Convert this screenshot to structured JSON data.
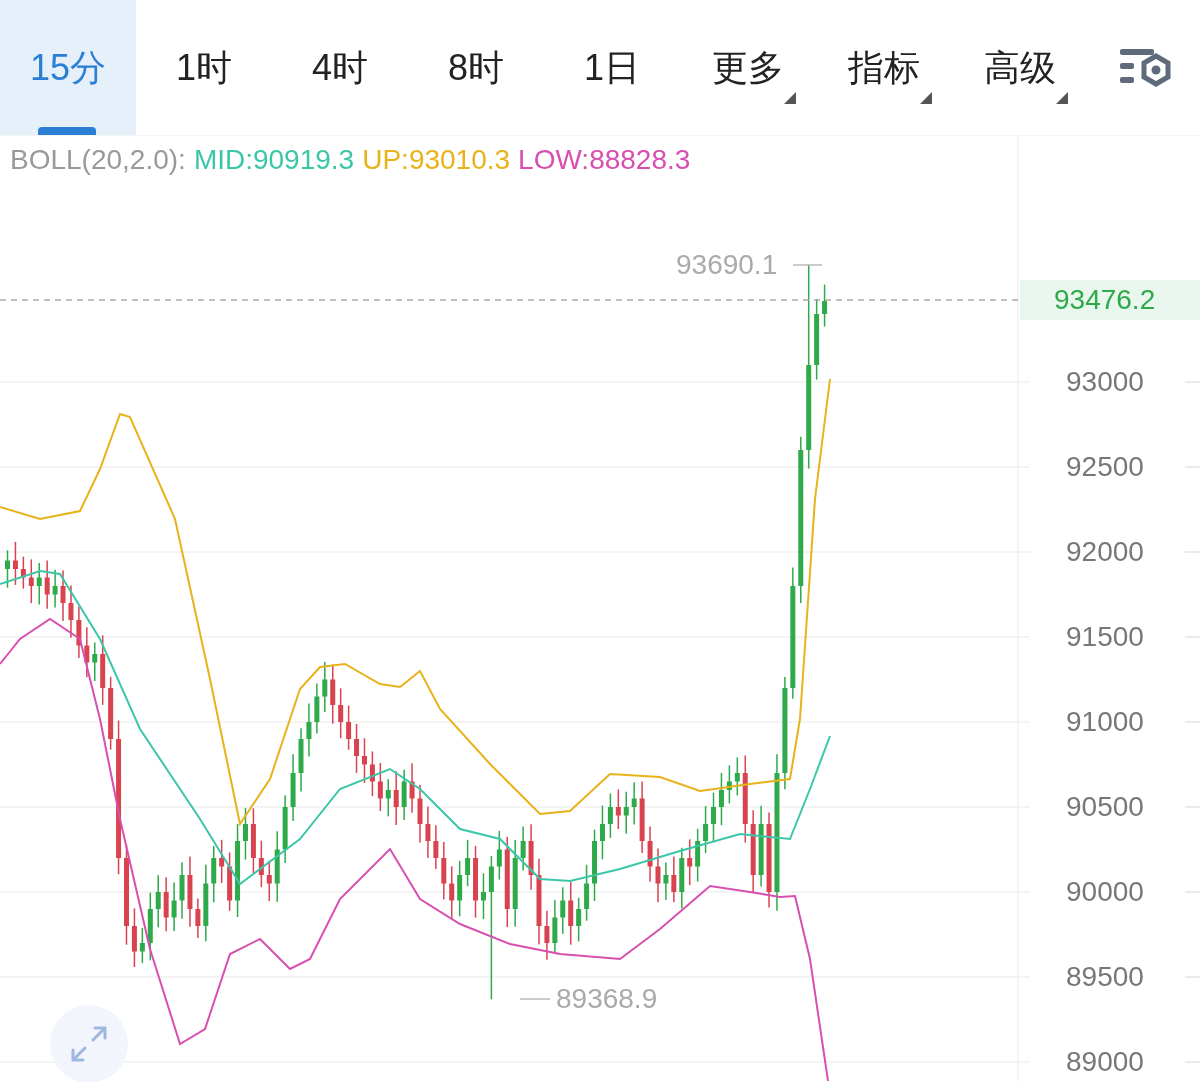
{
  "tabs": [
    {
      "label": "15分",
      "kind": "period",
      "selected": true
    },
    {
      "label": "1时",
      "kind": "period",
      "selected": false
    },
    {
      "label": "4时",
      "kind": "period",
      "selected": false
    },
    {
      "label": "8时",
      "kind": "period",
      "selected": false
    },
    {
      "label": "1日",
      "kind": "period",
      "selected": false
    },
    {
      "label": "更多",
      "kind": "menu",
      "selected": false
    },
    {
      "label": "指标",
      "kind": "menu",
      "selected": false
    },
    {
      "label": "高级",
      "kind": "menu",
      "selected": false
    }
  ],
  "indicator": {
    "name": "BOLL(20,2.0):",
    "values": [
      {
        "label": "MID:90919.3",
        "color": "#3cc6a8"
      },
      {
        "label": "UP:93010.3",
        "color": "#e8b21a"
      },
      {
        "label": "LOW:88828.3",
        "color": "#d84fb0"
      }
    ]
  },
  "chart": {
    "high_marker": "93690.1",
    "low_marker": "89368.9",
    "current_price": "93476.2",
    "price_ticks": [
      "93000",
      "92500",
      "92000",
      "91500",
      "91000",
      "90500",
      "90000",
      "89500",
      "89000"
    ]
  }
}
